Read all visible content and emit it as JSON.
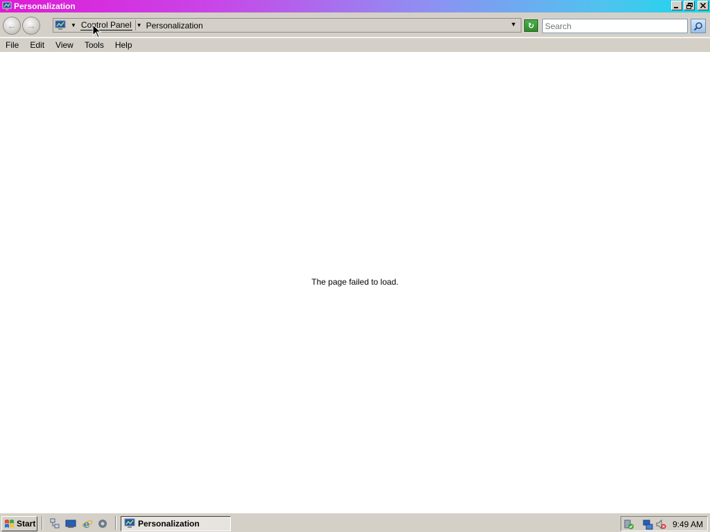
{
  "window": {
    "title": "Personalization",
    "icon": "personalization-monitor-icon",
    "minimize_icon": "minimize-icon",
    "restore_icon": "restore-icon",
    "close_icon": "close-icon"
  },
  "addressbar": {
    "back_icon": "back-arrow-icon",
    "forward_icon": "forward-arrow-icon",
    "location_icon": "personalization-monitor-icon",
    "breadcrumbs": [
      "Control Panel",
      "Personalization"
    ],
    "refresh_icon": "refresh-icon",
    "search_placeholder": "Search",
    "search_icon": "search-icon"
  },
  "menubar": {
    "items": [
      "File",
      "Edit",
      "View",
      "Tools",
      "Help"
    ]
  },
  "content": {
    "message": "The page failed to load."
  },
  "taskbar": {
    "start_label": "Start",
    "quicklaunch": [
      "network-icon",
      "show-desktop-icon",
      "internet-explorer-icon",
      "media-icon"
    ],
    "active_task": "Personalization",
    "tray_icons": [
      "security-shield-icon",
      "network-status-icon",
      "volume-muted-icon"
    ],
    "clock": "9:49 AM"
  },
  "colors": {
    "titlebar_start": "#e01ad6",
    "titlebar_end": "#18d8ec",
    "chrome": "#d4d0c8"
  }
}
